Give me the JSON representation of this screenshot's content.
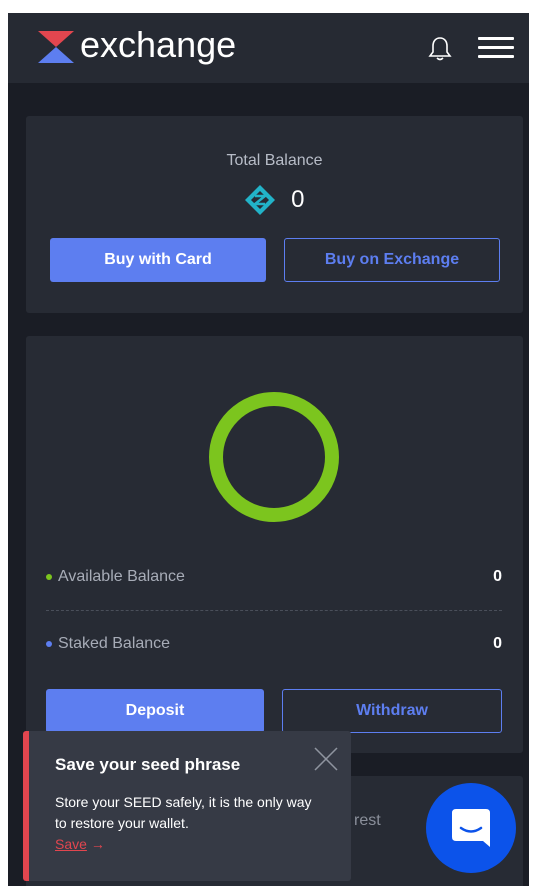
{
  "header": {
    "brand": "exchange",
    "icons": {
      "logo": "exchange-logo",
      "notifications": "bell-icon",
      "menu": "hamburger-menu-icon"
    }
  },
  "balance_card": {
    "label": "Total Balance",
    "value": "0",
    "coin_icon": "token-diamond-icon",
    "buy_card_label": "Buy with Card",
    "buy_exchange_label": "Buy on Exchange"
  },
  "wallet_card": {
    "ring_color": "#7cc51e",
    "available": {
      "label": "Available Balance",
      "value": "0",
      "color": "#7cc51e"
    },
    "staked": {
      "label": "Staked Balance",
      "value": "0",
      "color": "#5d7ef0"
    },
    "deposit_label": "Deposit",
    "withdraw_label": "Withdraw"
  },
  "interest_card": {
    "text_fragment": "rest"
  },
  "toast": {
    "title": "Save your seed phrase",
    "body": "Store your SEED safely, it is the only way to restore your wallet.",
    "link_label": "Save",
    "link_arrow": "→",
    "accent_color": "#e2464f"
  },
  "chat": {
    "icon": "chat-bubble-icon",
    "color": "#0c53ea"
  },
  "colors": {
    "accent": "#5d7ef0",
    "background": "#1a1d25",
    "card": "#272b34"
  }
}
